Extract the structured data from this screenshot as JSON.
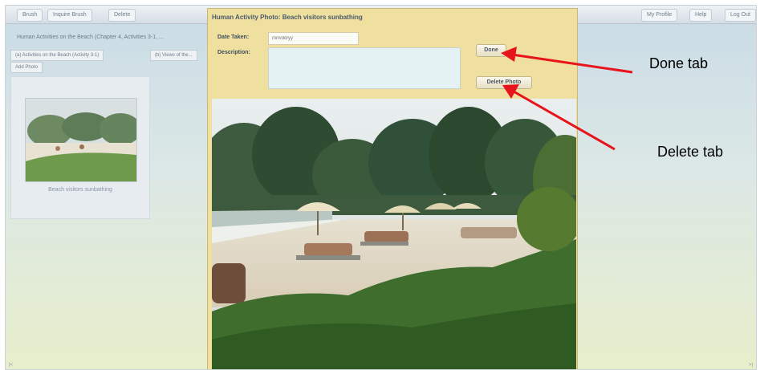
{
  "nav": {
    "left": [
      "Brush",
      "Inquire Brush",
      "Delete"
    ],
    "right": [
      "My Profile",
      "Help",
      "Log Out"
    ]
  },
  "breadcrumb": "Human Activities on the Beach (Chapter 4, Activities 3-1, ...",
  "tabs": [
    "(a) Activities on the Beach (Activity 3-1)",
    "(b) Views of the..."
  ],
  "add_photo_label": "Add Photo",
  "gallery": {
    "caption": "Beach visitors sunbathing"
  },
  "modal": {
    "title": "Human Activity Photo: Beach visitors sunbathing",
    "date_label": "Date Taken:",
    "date_placeholder": "mm/dd/yy",
    "description_label": "Description:",
    "done_label": "Done",
    "delete_label": "Delete Photo"
  },
  "annotations": {
    "done": "Done tab",
    "delete": "Delete tab"
  },
  "scroll": {
    "left": "|<",
    "right": ">|"
  },
  "colors": {
    "arrow": "#e8141b",
    "modal_bg": "#efe0a0",
    "textarea_bg": "#e4f2f4"
  }
}
